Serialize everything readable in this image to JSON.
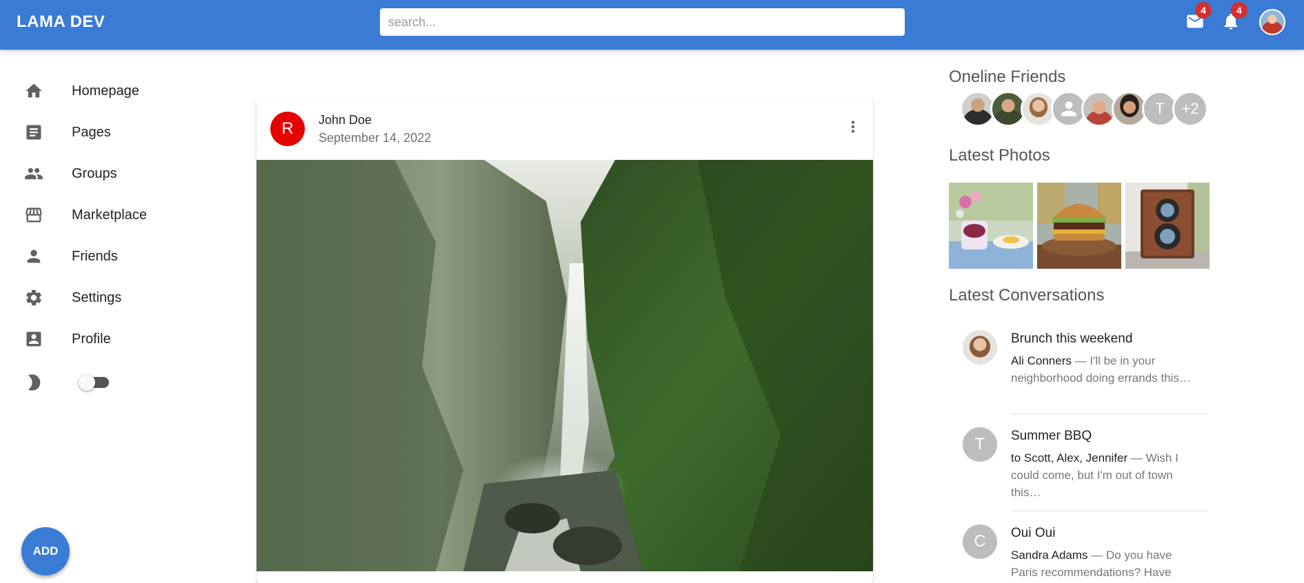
{
  "navbar": {
    "logo": "LAMA DEV",
    "search_placeholder": "search...",
    "mail_count": "4",
    "notifications_count": "4"
  },
  "sidebar": {
    "items": [
      {
        "label": "Homepage",
        "icon": "home-icon"
      },
      {
        "label": "Pages",
        "icon": "article-icon"
      },
      {
        "label": "Groups",
        "icon": "group-icon"
      },
      {
        "label": "Marketplace",
        "icon": "storefront-icon"
      },
      {
        "label": "Friends",
        "icon": "person-icon"
      },
      {
        "label": "Settings",
        "icon": "gear-icon"
      },
      {
        "label": "Profile",
        "icon": "account-box-icon"
      }
    ],
    "dark_mode_enabled": false,
    "add_button_label": "ADD"
  },
  "post": {
    "avatar_letter": "R",
    "author": "John Doe",
    "date": "September 14, 2022"
  },
  "rightbar": {
    "online_friends_title": "Oneline Friends",
    "online_friends": [
      {
        "label": "",
        "type": "photo"
      },
      {
        "label": "",
        "type": "photo"
      },
      {
        "label": "",
        "type": "photo"
      },
      {
        "label": "",
        "type": "placeholder"
      },
      {
        "label": "",
        "type": "photo"
      },
      {
        "label": "",
        "type": "photo"
      },
      {
        "label": "T",
        "type": "letter"
      },
      {
        "label": "+2",
        "type": "more"
      }
    ],
    "latest_photos_title": "Latest Photos",
    "latest_photos": [
      "breakfast",
      "burger",
      "camera"
    ],
    "latest_conversations_title": "Latest Conversations",
    "conversations": [
      {
        "title": "Brunch this weekend",
        "who": "Ali Conners",
        "text": " — I'll be in your neighborhood doing errands this…",
        "avatar": ""
      },
      {
        "title": "Summer BBQ",
        "who": "to Scott, Alex, Jennifer",
        "text": " — Wish I could come, but I'm out of town this…",
        "avatar": "T"
      },
      {
        "title": "Oui Oui",
        "who": "Sandra Adams",
        "text": " — Do you have Paris recommendations? Have",
        "avatar": "C"
      }
    ]
  },
  "colors": {
    "primary": "#3a7bd5",
    "badge": "#d32f2f",
    "post_avatar": "#e60000"
  }
}
